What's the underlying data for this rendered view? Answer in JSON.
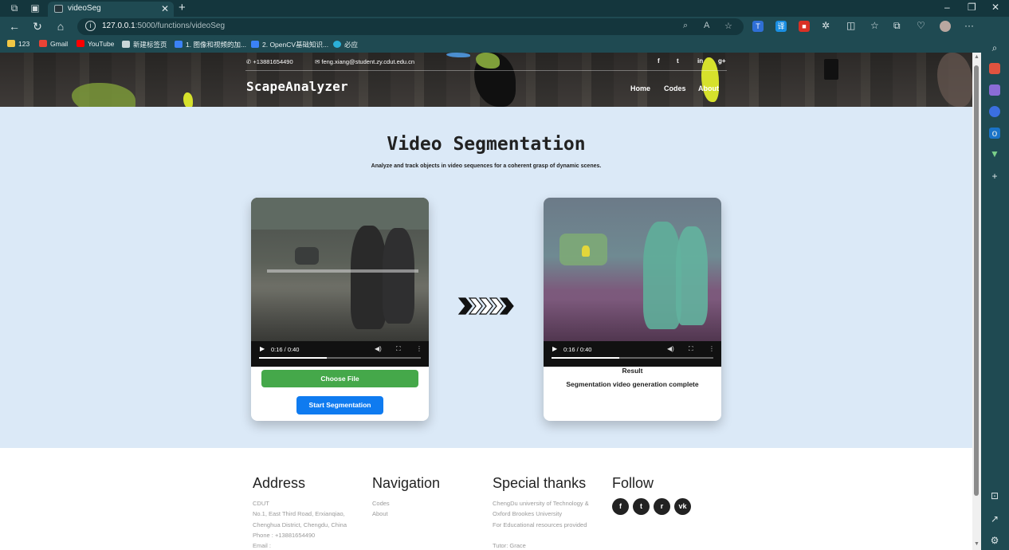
{
  "browser": {
    "tab_title": "videoSeg",
    "url_host": "127.0.0.1",
    "url_rest": ":5000/functions/videoSeg",
    "bookmarks": [
      {
        "label": "123",
        "color": "#f2c744"
      },
      {
        "label": "Gmail",
        "color": "#ea4335"
      },
      {
        "label": "YouTube",
        "color": "#ff0000"
      },
      {
        "label": "新建标签页",
        "color": "#c9d6d8"
      },
      {
        "label": "1. 图像和视频的加...",
        "color": "#3b82f6"
      },
      {
        "label": "2. OpenCV基础知识...",
        "color": "#3b82f6"
      },
      {
        "label": "必应",
        "color": "#2bb0d9"
      }
    ]
  },
  "site": {
    "phone": "+13881654490",
    "email": "feng.xiang@student.zy.cdut.edu.cn",
    "brand": "ScapeAnalyzer",
    "social": [
      "f",
      "t",
      "in",
      "g+"
    ],
    "nav": [
      "Home",
      "Codes",
      "About"
    ]
  },
  "main": {
    "title": "Video Segmentation",
    "subtitle": "Analyze and track objects in video sequences for a coherent grasp of dynamic scenes.",
    "input_card": {
      "time": "0:16 / 0:40",
      "progress": 0.42,
      "choose_label": "Choose File",
      "start_label": "Start Segmentation"
    },
    "result_card": {
      "time": "0:16 / 0:40",
      "progress": 0.42,
      "label": "Result",
      "message": "Segmentation video generation complete"
    }
  },
  "footer": {
    "address": {
      "heading": "Address",
      "lines": [
        "CDUT",
        "No.1, East Third Road, Erxianqiao,",
        "Chenghua District, Chengdu, China",
        "Phone : +13881654490",
        "Email :"
      ]
    },
    "navigation": {
      "heading": "Navigation",
      "links": [
        "Codes",
        "About"
      ]
    },
    "thanks": {
      "heading": "Special thanks",
      "lines": [
        "ChengDu university of Technology &",
        "Oxford Brookes University",
        "For Educational resources provided",
        "",
        "Tutor: Grace"
      ]
    },
    "follow": {
      "heading": "Follow",
      "icons": [
        "facebook-icon",
        "twitter-icon",
        "rss-icon",
        "vk-icon"
      ],
      "glyphs": [
        "f",
        "t",
        "r",
        "vk"
      ]
    }
  }
}
